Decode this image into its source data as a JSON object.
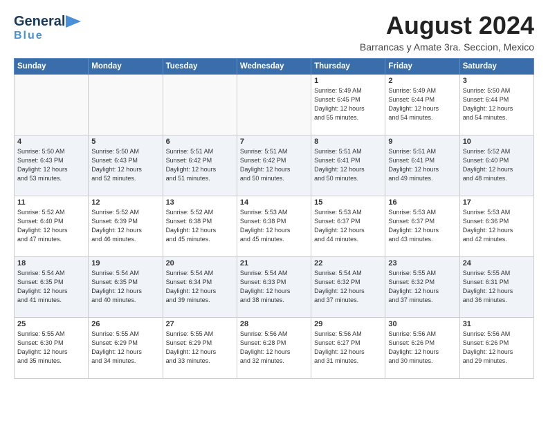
{
  "header": {
    "logo_general": "General",
    "logo_blue": "Blue",
    "title": "August 2024",
    "subtitle": "Barrancas y Amate 3ra. Seccion, Mexico"
  },
  "days_of_week": [
    "Sunday",
    "Monday",
    "Tuesday",
    "Wednesday",
    "Thursday",
    "Friday",
    "Saturday"
  ],
  "weeks": [
    [
      {
        "day": "",
        "info": ""
      },
      {
        "day": "",
        "info": ""
      },
      {
        "day": "",
        "info": ""
      },
      {
        "day": "",
        "info": ""
      },
      {
        "day": "1",
        "info": "Sunrise: 5:49 AM\nSunset: 6:45 PM\nDaylight: 12 hours\nand 55 minutes."
      },
      {
        "day": "2",
        "info": "Sunrise: 5:49 AM\nSunset: 6:44 PM\nDaylight: 12 hours\nand 54 minutes."
      },
      {
        "day": "3",
        "info": "Sunrise: 5:50 AM\nSunset: 6:44 PM\nDaylight: 12 hours\nand 54 minutes."
      }
    ],
    [
      {
        "day": "4",
        "info": "Sunrise: 5:50 AM\nSunset: 6:43 PM\nDaylight: 12 hours\nand 53 minutes."
      },
      {
        "day": "5",
        "info": "Sunrise: 5:50 AM\nSunset: 6:43 PM\nDaylight: 12 hours\nand 52 minutes."
      },
      {
        "day": "6",
        "info": "Sunrise: 5:51 AM\nSunset: 6:42 PM\nDaylight: 12 hours\nand 51 minutes."
      },
      {
        "day": "7",
        "info": "Sunrise: 5:51 AM\nSunset: 6:42 PM\nDaylight: 12 hours\nand 50 minutes."
      },
      {
        "day": "8",
        "info": "Sunrise: 5:51 AM\nSunset: 6:41 PM\nDaylight: 12 hours\nand 50 minutes."
      },
      {
        "day": "9",
        "info": "Sunrise: 5:51 AM\nSunset: 6:41 PM\nDaylight: 12 hours\nand 49 minutes."
      },
      {
        "day": "10",
        "info": "Sunrise: 5:52 AM\nSunset: 6:40 PM\nDaylight: 12 hours\nand 48 minutes."
      }
    ],
    [
      {
        "day": "11",
        "info": "Sunrise: 5:52 AM\nSunset: 6:40 PM\nDaylight: 12 hours\nand 47 minutes."
      },
      {
        "day": "12",
        "info": "Sunrise: 5:52 AM\nSunset: 6:39 PM\nDaylight: 12 hours\nand 46 minutes."
      },
      {
        "day": "13",
        "info": "Sunrise: 5:52 AM\nSunset: 6:38 PM\nDaylight: 12 hours\nand 45 minutes."
      },
      {
        "day": "14",
        "info": "Sunrise: 5:53 AM\nSunset: 6:38 PM\nDaylight: 12 hours\nand 45 minutes."
      },
      {
        "day": "15",
        "info": "Sunrise: 5:53 AM\nSunset: 6:37 PM\nDaylight: 12 hours\nand 44 minutes."
      },
      {
        "day": "16",
        "info": "Sunrise: 5:53 AM\nSunset: 6:37 PM\nDaylight: 12 hours\nand 43 minutes."
      },
      {
        "day": "17",
        "info": "Sunrise: 5:53 AM\nSunset: 6:36 PM\nDaylight: 12 hours\nand 42 minutes."
      }
    ],
    [
      {
        "day": "18",
        "info": "Sunrise: 5:54 AM\nSunset: 6:35 PM\nDaylight: 12 hours\nand 41 minutes."
      },
      {
        "day": "19",
        "info": "Sunrise: 5:54 AM\nSunset: 6:35 PM\nDaylight: 12 hours\nand 40 minutes."
      },
      {
        "day": "20",
        "info": "Sunrise: 5:54 AM\nSunset: 6:34 PM\nDaylight: 12 hours\nand 39 minutes."
      },
      {
        "day": "21",
        "info": "Sunrise: 5:54 AM\nSunset: 6:33 PM\nDaylight: 12 hours\nand 38 minutes."
      },
      {
        "day": "22",
        "info": "Sunrise: 5:54 AM\nSunset: 6:32 PM\nDaylight: 12 hours\nand 37 minutes."
      },
      {
        "day": "23",
        "info": "Sunrise: 5:55 AM\nSunset: 6:32 PM\nDaylight: 12 hours\nand 37 minutes."
      },
      {
        "day": "24",
        "info": "Sunrise: 5:55 AM\nSunset: 6:31 PM\nDaylight: 12 hours\nand 36 minutes."
      }
    ],
    [
      {
        "day": "25",
        "info": "Sunrise: 5:55 AM\nSunset: 6:30 PM\nDaylight: 12 hours\nand 35 minutes."
      },
      {
        "day": "26",
        "info": "Sunrise: 5:55 AM\nSunset: 6:29 PM\nDaylight: 12 hours\nand 34 minutes."
      },
      {
        "day": "27",
        "info": "Sunrise: 5:55 AM\nSunset: 6:29 PM\nDaylight: 12 hours\nand 33 minutes."
      },
      {
        "day": "28",
        "info": "Sunrise: 5:56 AM\nSunset: 6:28 PM\nDaylight: 12 hours\nand 32 minutes."
      },
      {
        "day": "29",
        "info": "Sunrise: 5:56 AM\nSunset: 6:27 PM\nDaylight: 12 hours\nand 31 minutes."
      },
      {
        "day": "30",
        "info": "Sunrise: 5:56 AM\nSunset: 6:26 PM\nDaylight: 12 hours\nand 30 minutes."
      },
      {
        "day": "31",
        "info": "Sunrise: 5:56 AM\nSunset: 6:26 PM\nDaylight: 12 hours\nand 29 minutes."
      }
    ]
  ]
}
